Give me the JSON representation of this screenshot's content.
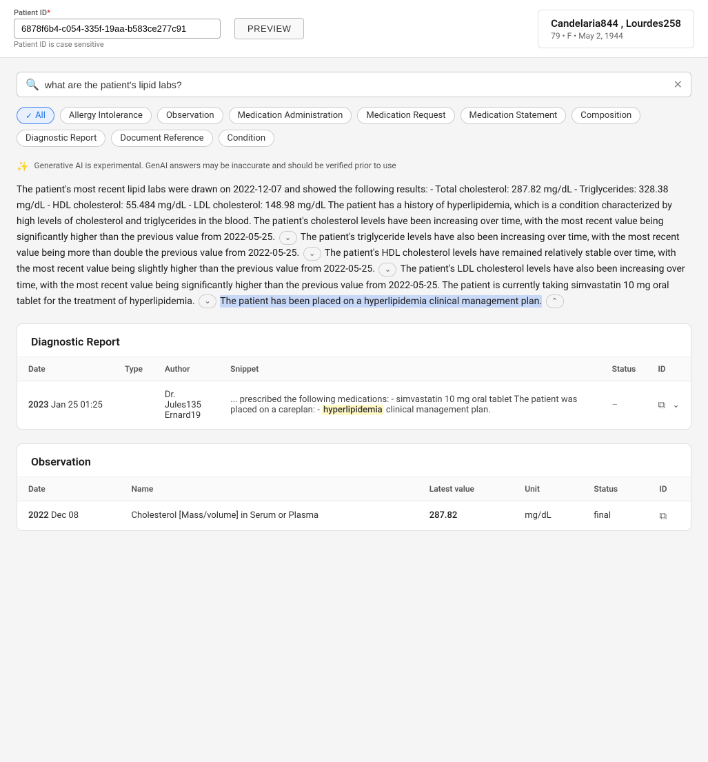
{
  "header": {
    "patient_id_label": "Patient ID",
    "required_marker": "*",
    "patient_id_value": "6878f6b4-c054-335f-19aa-b583ce277c91",
    "patient_id_hint": "Patient ID is case sensitive",
    "preview_button": "PREVIEW",
    "patient_name": "Candelaria844 , Lourdes258",
    "patient_details": "79 • F • May 2, 1944"
  },
  "search": {
    "placeholder": "what are the patient's lipid labs?",
    "value": "what are the patient's lipid labs?"
  },
  "filters": [
    {
      "id": "all",
      "label": "All",
      "active": true
    },
    {
      "id": "allergy",
      "label": "Allergy Intolerance",
      "active": false
    },
    {
      "id": "observation",
      "label": "Observation",
      "active": false
    },
    {
      "id": "med-admin",
      "label": "Medication Administration",
      "active": false
    },
    {
      "id": "med-request",
      "label": "Medication Request",
      "active": false
    },
    {
      "id": "med-statement",
      "label": "Medication Statement",
      "active": false
    },
    {
      "id": "composition",
      "label": "Composition",
      "active": false
    },
    {
      "id": "diagnostic",
      "label": "Diagnostic Report",
      "active": false
    },
    {
      "id": "doc-ref",
      "label": "Document Reference",
      "active": false
    },
    {
      "id": "condition",
      "label": "Condition",
      "active": false
    }
  ],
  "ai_notice": "Generative AI is experimental. GenAI answers may be inaccurate and should be verified prior to use",
  "ai_response": {
    "full_text": "The patient's most recent lipid labs were drawn on 2022-12-07 and showed the following results: - Total cholesterol: 287.82 mg/dL - Triglycerides: 328.38 mg/dL - HDL cholesterol: 55.484 mg/dL - LDL cholesterol: 148.98 mg/dL The patient has a history of hyperlipidemia, which is a condition characterized by high levels of cholesterol and triglycerides in the blood. The patient's cholesterol levels have been increasing over time, with the most recent value being significantly higher than the previous value from 2022-05-25.",
    "part2": "The patient's triglyceride levels have also been increasing over time, with the most recent value being more than double the previous value from 2022-05-25.",
    "part3": "The patient's HDL cholesterol levels have remained relatively stable over time, with the most recent value being slightly higher than the previous value from 2022-05-25.",
    "part4": "The patient's LDL cholesterol levels have also been increasing over time, with the most recent value being significantly higher than the previous value from 2022-05-25. The patient is currently taking simvastatin 10 mg oral tablet for the treatment of hyperlipidemia.",
    "highlighted_part": "The patient has been placed on a hyperlipidemia clinical management plan."
  },
  "diagnostic_report": {
    "title": "Diagnostic Report",
    "columns": [
      "Date",
      "Type",
      "Author",
      "Snippet",
      "Status",
      "ID"
    ],
    "rows": [
      {
        "date_year": "2023",
        "date_rest": "Jan  25  01:25",
        "type": "",
        "author_line1": "Dr. Jules135",
        "author_line2": "Ernard19",
        "snippet_before": "... prescribed the following medications: - simvastatin 10 mg oral tablet The patient was placed on a careplan: - ",
        "snippet_highlight": "hyperlipidemia",
        "snippet_after": " clinical management plan.",
        "status": "–",
        "id": "copy"
      }
    ]
  },
  "observation": {
    "title": "Observation",
    "columns": [
      "Date",
      "Name",
      "Latest value",
      "Unit",
      "Status",
      "ID"
    ],
    "rows": [
      {
        "date_year": "2022",
        "date_rest": "Dec  08",
        "name": "Cholesterol [Mass/volume] in Serum or Plasma",
        "latest_value": "287.82",
        "unit": "mg/dL",
        "status": "final",
        "id": "copy"
      }
    ]
  }
}
